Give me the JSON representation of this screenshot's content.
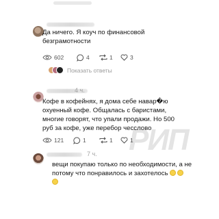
{
  "comments": [
    {
      "time": "",
      "text_lines": [
        "Да ничего. Я коуч по финансовой",
        "безграмотности"
      ],
      "views": "602",
      "replies_count": "4",
      "reposts": "1",
      "likes": "3",
      "show_replies": "Показать ответы"
    },
    {
      "time": "4 ч.",
      "text_lines": [
        "Кофе в кофейнях, я дома себе навар�ю",
        "охуенный кофе. Общалась с баристами,",
        "многие говорят, что упали продажи. Но 500",
        "руб за кофе, уже перебор чесслово"
      ],
      "views": "121",
      "replies_count": "1",
      "reposts": "1",
      "likes": "1"
    },
    {
      "time": "7 ч.",
      "text_lines": [
        "вещи покупаю только по необходимости, а не",
        "потому что понравилось и захотелось"
      ]
    }
  ],
  "watermark": "РИП",
  "icons": {
    "views": "eye-icon",
    "replies": "speech-bubble-icon",
    "reposts": "repost-icon",
    "likes": "heart-icon"
  },
  "colors": {
    "text": "#151515",
    "muted": "#9a9a9a"
  }
}
